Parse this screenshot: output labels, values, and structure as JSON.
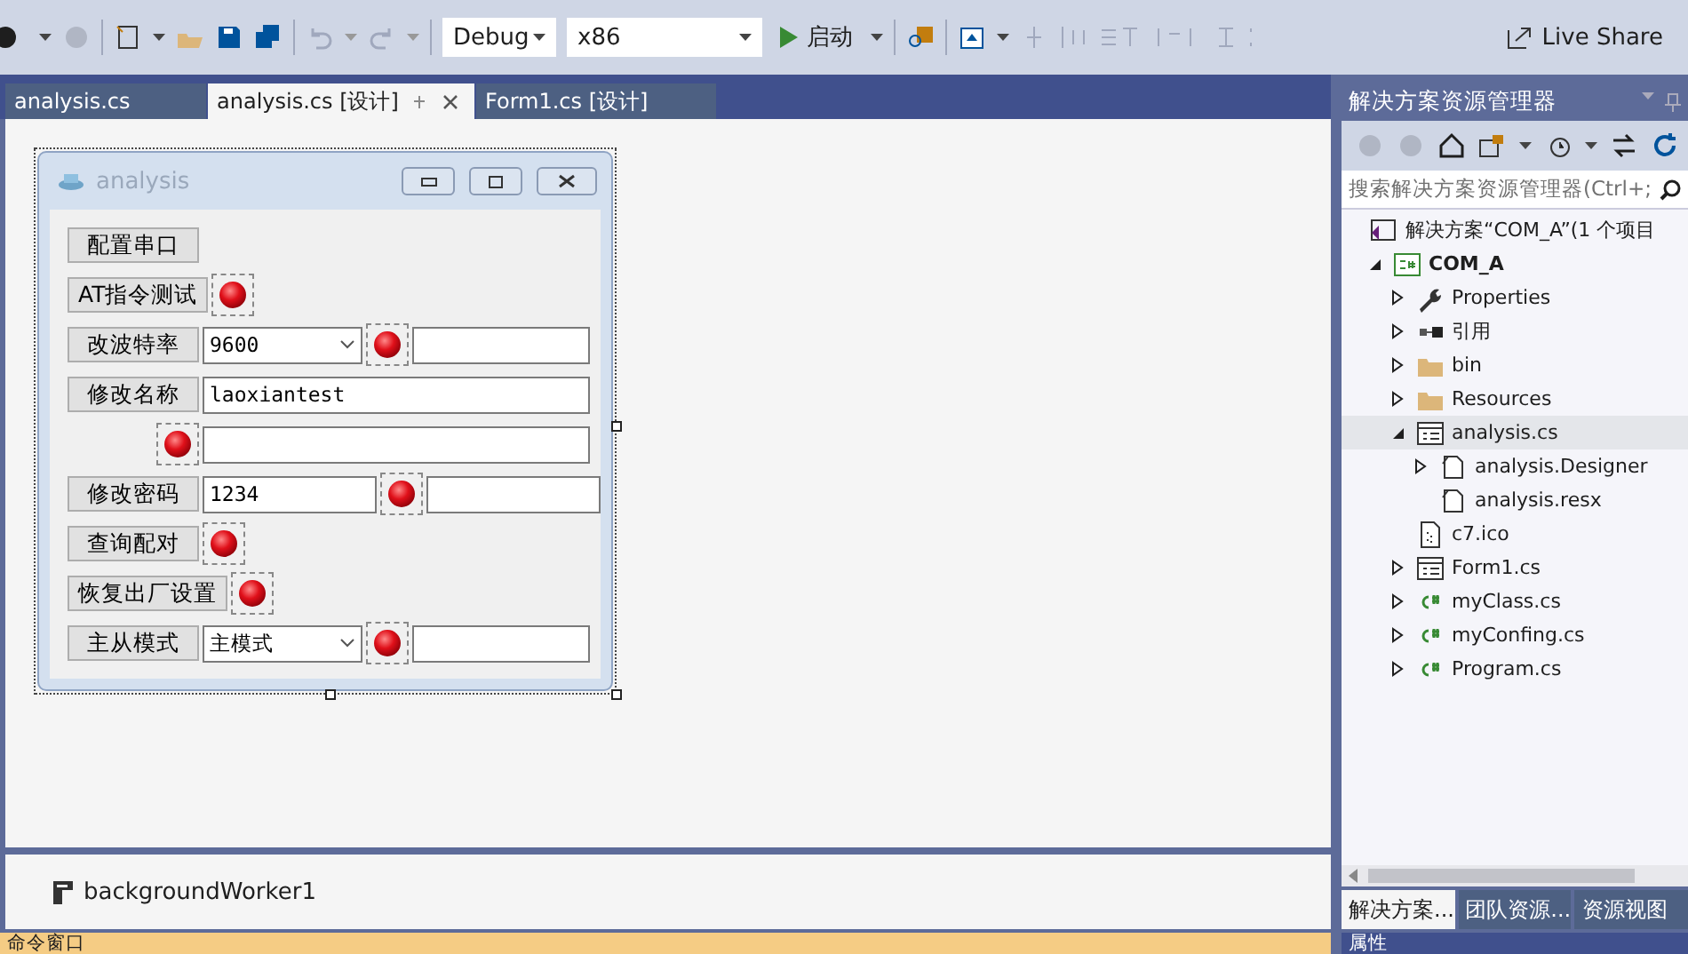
{
  "toolbar": {
    "configuration": "Debug",
    "platform": "x86",
    "start": "启动",
    "live_share": "Live Share"
  },
  "doc_tabs": [
    {
      "label": "analysis.cs",
      "selected": false
    },
    {
      "label": "analysis.cs [设计]",
      "selected": true
    },
    {
      "label": "Form1.cs [设计]",
      "selected": false
    }
  ],
  "form": {
    "title": "analysis",
    "rows": [
      {
        "items": [
          {
            "kind": "button",
            "label": "配置串口"
          }
        ]
      },
      {
        "items": [
          {
            "kind": "button",
            "label": "AT指令测试"
          },
          {
            "kind": "led"
          }
        ]
      },
      {
        "items": [
          {
            "kind": "button",
            "label": "改波特率"
          },
          {
            "kind": "combo",
            "value": "9600"
          },
          {
            "kind": "led"
          },
          {
            "kind": "textbox"
          }
        ]
      },
      {
        "items": [
          {
            "kind": "button",
            "label": "修改名称"
          },
          {
            "kind": "widebox",
            "value": "laoxiantest"
          }
        ]
      },
      {
        "items": [
          {
            "kind": "led"
          },
          {
            "kind": "widebox"
          }
        ]
      },
      {
        "items": [
          {
            "kind": "button",
            "label": "修改密码"
          },
          {
            "kind": "textbox",
            "value": "1234"
          },
          {
            "kind": "led"
          },
          {
            "kind": "textbox"
          }
        ]
      },
      {
        "items": [
          {
            "kind": "button",
            "label": "查询配对"
          },
          {
            "kind": "led"
          }
        ]
      },
      {
        "items": [
          {
            "kind": "button",
            "label": "恢复出厂设置"
          },
          {
            "kind": "led"
          }
        ]
      },
      {
        "items": [
          {
            "kind": "button",
            "label": "主从模式"
          },
          {
            "kind": "combo",
            "value": "主模式"
          },
          {
            "kind": "led"
          },
          {
            "kind": "textbox"
          }
        ]
      }
    ]
  },
  "tray": [
    {
      "label": "backgroundWorker1"
    }
  ],
  "solution_explorer": {
    "title": "解决方案资源管理器",
    "search": {
      "placeholder": "搜索解决方案资源管理器(Ctrl+;"
    },
    "tree": [
      {
        "label": "解决方案“COM_A”(1 个项目",
        "kind": "solution",
        "selected": false,
        "children": [
          {
            "label": "COM_A",
            "kind": "project",
            "expanded": true,
            "selected": false,
            "children": [
              {
                "label": "Properties",
                "kind": "wrench",
                "expanded": false,
                "selected": false
              },
              {
                "label": "引用",
                "kind": "refs",
                "expanded": false,
                "selected": false
              },
              {
                "label": "bin",
                "kind": "folder",
                "expanded": false,
                "selected": false
              },
              {
                "label": "Resources",
                "kind": "folder",
                "expanded": false,
                "selected": false
              },
              {
                "label": "analysis.cs",
                "kind": "form",
                "expanded": true,
                "selected": true,
                "children": [
                  {
                    "label": "analysis.Designer",
                    "kind": "file",
                    "expanded": false,
                    "selected": false
                  },
                  {
                    "label": "analysis.resx",
                    "kind": "file",
                    "selected": false
                  }
                ]
              },
              {
                "label": "c7.ico",
                "kind": "ico",
                "selected": false
              },
              {
                "label": "Form1.cs",
                "kind": "form",
                "expanded": false,
                "selected": false
              },
              {
                "label": "myClass.cs",
                "kind": "cs",
                "expanded": false,
                "selected": false
              },
              {
                "label": "myConfing.cs",
                "kind": "cs",
                "expanded": false,
                "selected": false
              },
              {
                "label": "Program.cs",
                "kind": "cs",
                "expanded": false,
                "selected": false
              }
            ]
          }
        ]
      }
    ],
    "bottom_tabs": [
      {
        "label": "解决方案...",
        "selected": true
      },
      {
        "label": "团队资源...",
        "selected": false
      },
      {
        "label": "资源视图",
        "selected": false
      }
    ]
  },
  "command_window": {
    "title": "命令窗口"
  },
  "properties_panel": {
    "title": "属性"
  }
}
